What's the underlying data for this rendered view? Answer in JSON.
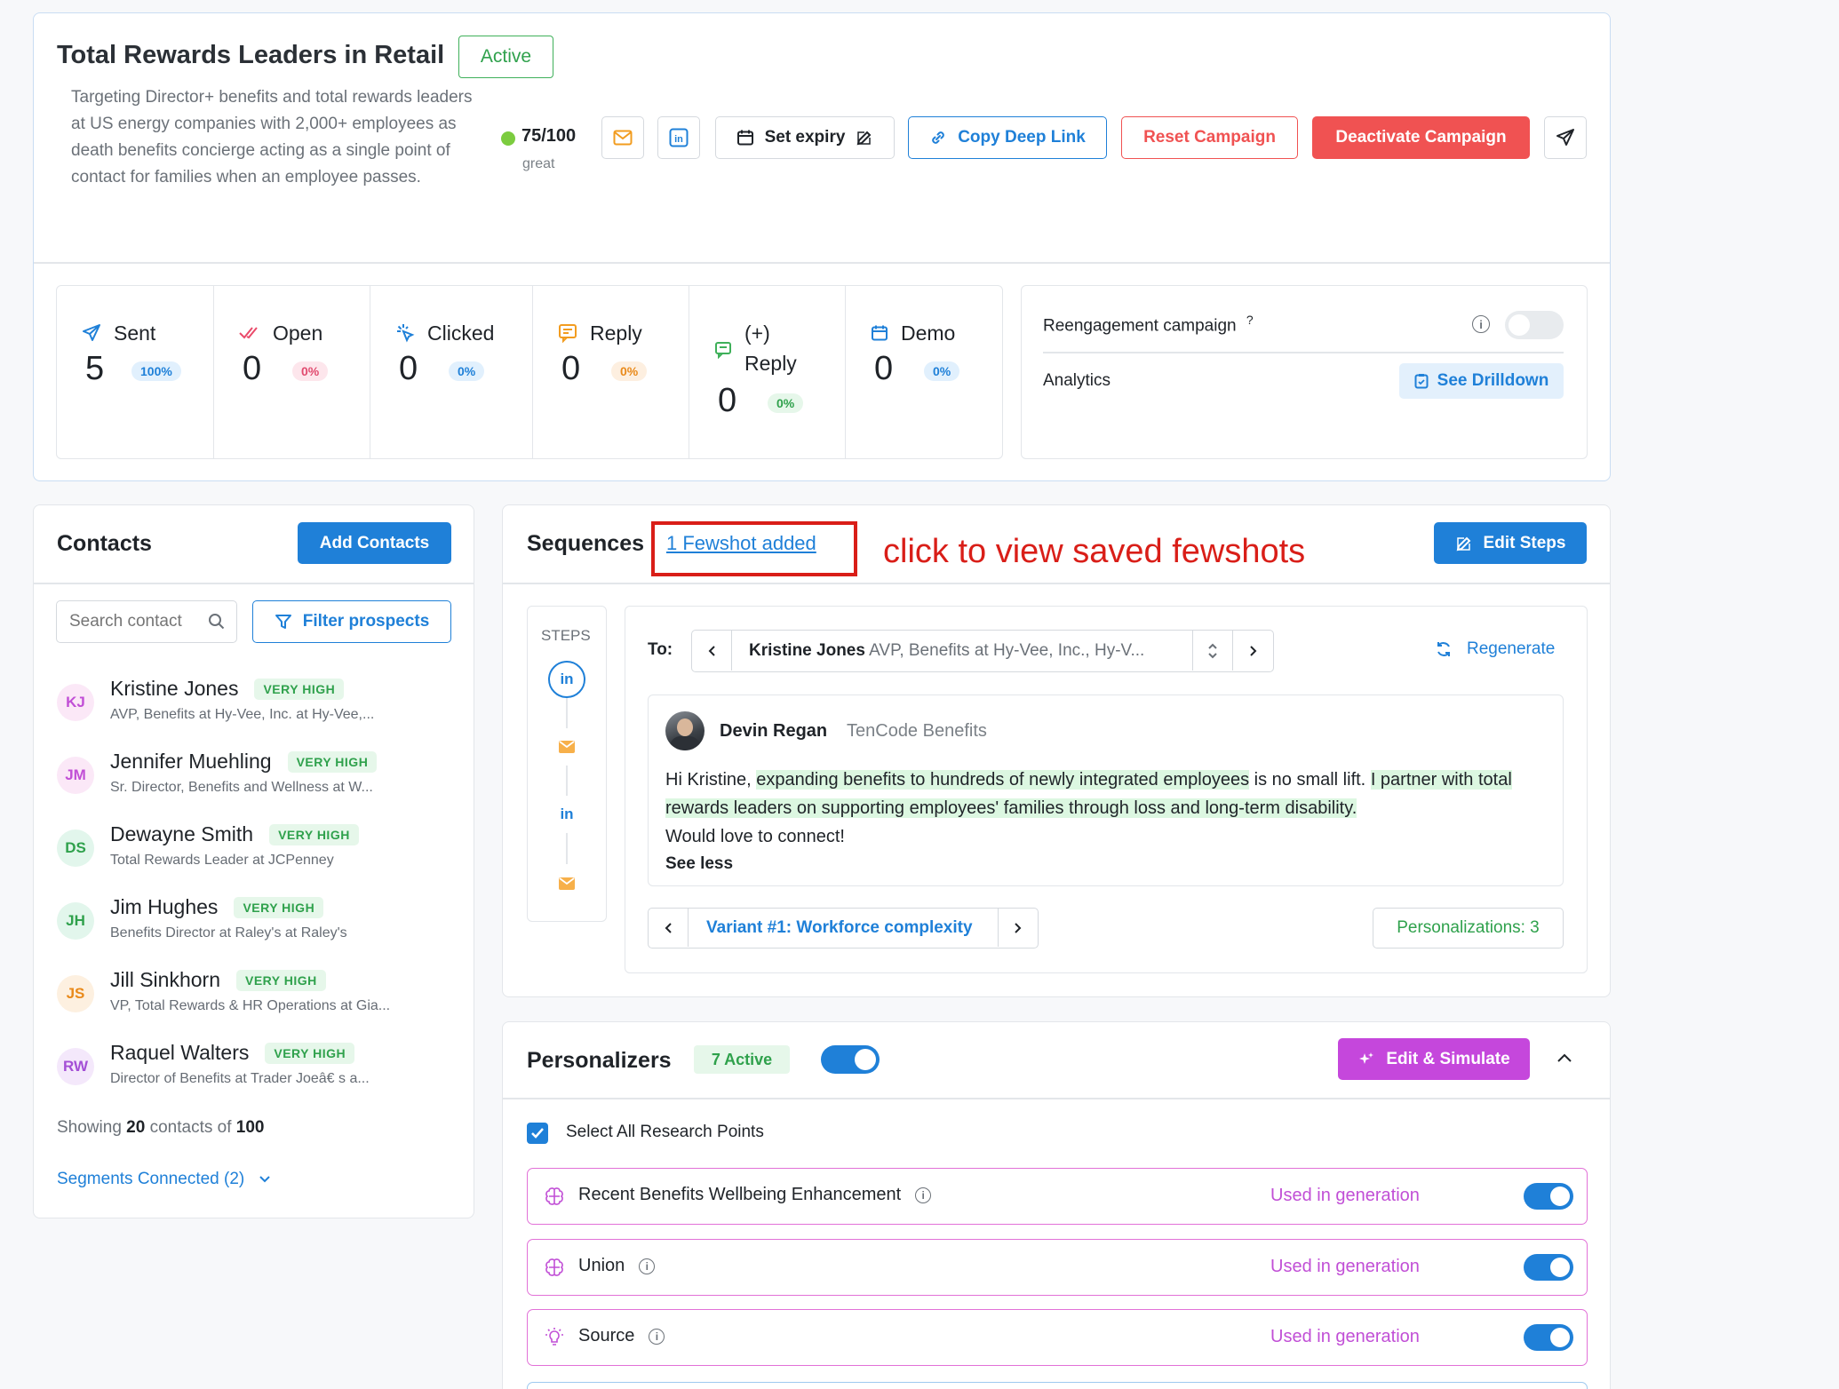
{
  "campaign": {
    "title": "Total Rewards Leaders in Retail",
    "status": "Active",
    "description": "Targeting Director+ benefits and total rewards leaders at US energy companies with 2,000+ employees as death benefits concierge acting as a single point of contact for families when an employee passes.",
    "score": "75/100",
    "score_label": "great",
    "set_expiry": "Set expiry",
    "copy_deep_link": "Copy Deep Link",
    "reset": "Reset Campaign",
    "deactivate": "Deactivate Campaign"
  },
  "stats": [
    {
      "label": "Sent",
      "value": "5",
      "pct": "100%"
    },
    {
      "label": "Open",
      "value": "0",
      "pct": "0%"
    },
    {
      "label": "Clicked",
      "value": "0",
      "pct": "0%"
    },
    {
      "label": "Reply",
      "value": "0",
      "pct": "0%"
    },
    {
      "label": "(+) Reply",
      "label_line1": "(+)",
      "label_line2": "Reply",
      "value": "0",
      "pct": "0%"
    },
    {
      "label": "Demo",
      "value": "0",
      "pct": "0%"
    }
  ],
  "side_panel": {
    "reengagement": "Reengagement campaign",
    "help": "?",
    "analytics": "Analytics",
    "drilldown": "See Drilldown"
  },
  "contacts": {
    "title": "Contacts",
    "add": "Add Contacts",
    "search_placeholder": "Search contact",
    "filter": "Filter prospects",
    "items": [
      {
        "initials": "KJ",
        "name": "Kristine Jones",
        "tag": "VERY HIGH",
        "sub": "AVP, Benefits at Hy-Vee, Inc. at Hy-Vee,..."
      },
      {
        "initials": "JM",
        "name": "Jennifer Muehling",
        "tag": "VERY HIGH",
        "sub": "Sr. Director, Benefits and Wellness at W..."
      },
      {
        "initials": "DS",
        "name": "Dewayne Smith",
        "tag": "VERY HIGH",
        "sub": "Total Rewards Leader at JCPenney"
      },
      {
        "initials": "JH",
        "name": "Jim Hughes",
        "tag": "VERY HIGH",
        "sub": "Benefits Director at Raley's at Raley's"
      },
      {
        "initials": "JS",
        "name": "Jill Sinkhorn",
        "tag": "VERY HIGH",
        "sub": "VP, Total Rewards & HR Operations at Gia..."
      },
      {
        "initials": "RW",
        "name": "Raquel Walters",
        "tag": "VERY HIGH",
        "sub": "Director of Benefits at Trader Joeâ€    s a..."
      }
    ],
    "showing_prefix": "Showing",
    "showing_count": "20",
    "showing_mid": "contacts of",
    "showing_total": "100",
    "segments": "Segments Connected (2)"
  },
  "sequences": {
    "title": "Sequences",
    "fewshot_link": "1 Fewshot added",
    "annotation": "click to view saved fewshots",
    "edit_steps": "Edit Steps",
    "steps_label": "STEPS",
    "to_label": "To:",
    "recipient_name": "Kristine Jones",
    "recipient_detail": "AVP, Benefits at Hy-Vee, Inc., Hy-V...",
    "regenerate": "Regenerate",
    "sender_name": "Devin Regan",
    "sender_company": "TenCode Benefits",
    "msg_greeting": "Hi Kristine,",
    "msg_hl1": "expanding benefits to hundreds of newly integrated employees",
    "msg_mid": "is no small lift.",
    "msg_hl2": "I partner with total rewards leaders on supporting employees' families through loss and long-term disability.",
    "msg_end": "Would love to connect!",
    "see_less": "See less",
    "variant": "Variant #1: Workforce complexity",
    "personalizations": "Personalizations: 3"
  },
  "personalizers": {
    "title": "Personalizers",
    "active_badge": "7 Active",
    "edit_simulate": "Edit & Simulate",
    "select_all": "Select All Research Points",
    "items": [
      {
        "label": "Recent Benefits Wellbeing Enhancement",
        "status": "Used in generation",
        "icon": "brain-icon"
      },
      {
        "label": "Union",
        "status": "Used in generation",
        "icon": "brain-icon"
      },
      {
        "label": "Source",
        "status": "Used in generation",
        "icon": "lightbulb-icon"
      }
    ]
  },
  "colors": {
    "primary": "#1f80d8",
    "danger": "#f05252",
    "success": "#2fa14c",
    "purple": "#c14fd6",
    "annotation": "#d91e18"
  }
}
